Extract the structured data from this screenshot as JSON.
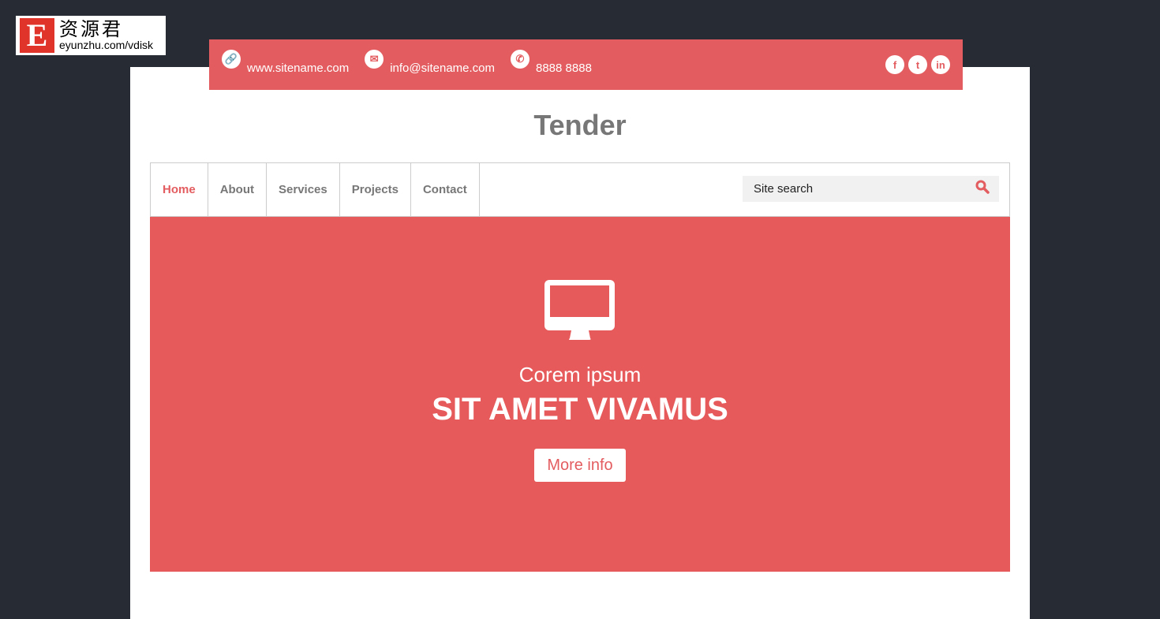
{
  "watermark": {
    "mark": "E",
    "cn": "资源君",
    "url": "eyunzhu.com/vdisk"
  },
  "topbar": {
    "website": "www.sitename.com",
    "email": "info@sitename.com",
    "phone": "8888 8888",
    "social": [
      "facebook",
      "twitter",
      "linkedin"
    ]
  },
  "site_title": "Tender",
  "nav": {
    "items": [
      "Home",
      "About",
      "Services",
      "Projects",
      "Contact"
    ],
    "active": "Home",
    "search_placeholder": "Site search"
  },
  "hero": {
    "subtitle": "Corem ipsum",
    "headline": "SIT AMET VIVAMUS",
    "button": "More info",
    "icon": "desktop-monitor-icon"
  },
  "colors": {
    "accent": "#e35d60",
    "background": "#272b33"
  }
}
